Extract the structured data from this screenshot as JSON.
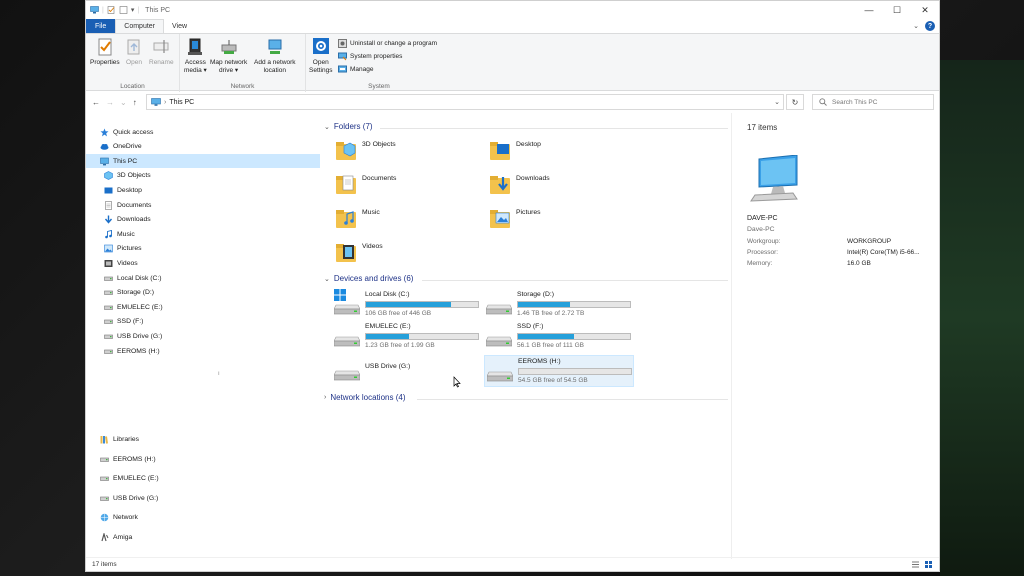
{
  "window": {
    "title": "This PC"
  },
  "ribbon": {
    "tabs": [
      "File",
      "Computer",
      "View"
    ],
    "location": {
      "label": "Location",
      "properties": "Properties",
      "open": "Open",
      "rename": "Rename"
    },
    "network": {
      "label": "Network",
      "access_media": "Access\nmedia ▾",
      "map_drive": "Map network\ndrive ▾",
      "add_location": "Add a network\nlocation"
    },
    "system": {
      "label": "System",
      "open_settings": "Open\nSettings",
      "uninstall": "Uninstall or change a program",
      "system_properties": "System properties",
      "manage": "Manage"
    }
  },
  "address": {
    "path": "This PC",
    "search_placeholder": "Search This PC"
  },
  "nav_items": [
    {
      "label": "Quick access",
      "icon": "star-icon",
      "indent": 1
    },
    {
      "label": "OneDrive",
      "icon": "cloud-icon",
      "indent": 1
    },
    {
      "label": "This PC",
      "icon": "pc-icon",
      "indent": 1,
      "selected": true
    },
    {
      "label": "3D Objects",
      "icon": "cube-icon",
      "indent": 2
    },
    {
      "label": "Desktop",
      "icon": "desktop-icon",
      "indent": 2
    },
    {
      "label": "Documents",
      "icon": "document-icon",
      "indent": 2
    },
    {
      "label": "Downloads",
      "icon": "download-icon",
      "indent": 2
    },
    {
      "label": "Music",
      "icon": "music-icon",
      "indent": 2
    },
    {
      "label": "Pictures",
      "icon": "picture-icon",
      "indent": 2
    },
    {
      "label": "Videos",
      "icon": "video-icon",
      "indent": 2
    },
    {
      "label": "Local Disk (C:)",
      "icon": "drive-icon",
      "indent": 2
    },
    {
      "label": "Storage (D:)",
      "icon": "drive-icon",
      "indent": 2
    },
    {
      "label": "EMUELEC (E:)",
      "icon": "drive-icon",
      "indent": 2
    },
    {
      "label": "SSD (F:)",
      "icon": "drive-icon",
      "indent": 2
    },
    {
      "label": "USB Drive (G:)",
      "icon": "drive-icon",
      "indent": 2
    },
    {
      "label": "EEROMS (H:)",
      "icon": "drive-icon",
      "indent": 2
    }
  ],
  "nav_items_lower": [
    {
      "label": "Libraries",
      "icon": "library-icon"
    },
    {
      "label": "EEROMS (H:)",
      "icon": "drive-icon"
    },
    {
      "label": "EMUELEC (E:)",
      "icon": "drive-icon"
    },
    {
      "label": "USB Drive (G:)",
      "icon": "drive-icon"
    },
    {
      "label": "Network",
      "icon": "network-icon"
    },
    {
      "label": "Amiga",
      "icon": "amiga-icon"
    }
  ],
  "groups": {
    "folders": "Folders (7)",
    "devices": "Devices and drives (6)",
    "network": "Network locations (4)"
  },
  "folders": [
    {
      "label": "3D Objects",
      "icon": "cube-folder-icon"
    },
    {
      "label": "Desktop",
      "icon": "desktop-folder-icon"
    },
    {
      "label": "Documents",
      "icon": "documents-folder-icon"
    },
    {
      "label": "Downloads",
      "icon": "downloads-folder-icon"
    },
    {
      "label": "Music",
      "icon": "music-folder-icon"
    },
    {
      "label": "Pictures",
      "icon": "pictures-folder-icon"
    },
    {
      "label": "Videos",
      "icon": "videos-folder-icon"
    }
  ],
  "drives": [
    {
      "name": "Local Disk (C:)",
      "free": "106 GB free of 446 GB",
      "used_fraction": 0.76,
      "windows": true
    },
    {
      "name": "Storage (D:)",
      "free": "1.46 TB free of 2.72 TB",
      "used_fraction": 0.46
    },
    {
      "name": "EMUELEC (E:)",
      "free": "1.23 GB free of 1.99 GB",
      "used_fraction": 0.38
    },
    {
      "name": "SSD (F:)",
      "free": "56.1 GB free of 111 GB",
      "used_fraction": 0.5
    },
    {
      "name": "USB Drive (G:)",
      "free": "",
      "used_fraction": null
    },
    {
      "name": "EEROMS (H:)",
      "free": "54.5 GB free of 54.5 GB",
      "used_fraction": 0.0,
      "selected": true
    }
  ],
  "details": {
    "count": "17 items",
    "computer_name": "DAVE-PC",
    "computer_sub": "Dave-PC",
    "rows": [
      {
        "k": "Workgroup:",
        "v": "WORKGROUP"
      },
      {
        "k": "Processor:",
        "v": "Intel(R) Core(TM) i5-66..."
      },
      {
        "k": "Memory:",
        "v": "16.0 GB"
      }
    ]
  },
  "status": {
    "count": "17 items"
  },
  "colors": {
    "accent": "#1a5fb4",
    "bar_fill": "#26a0da",
    "selection": "#cce8ff",
    "group_header": "#1e3287"
  }
}
